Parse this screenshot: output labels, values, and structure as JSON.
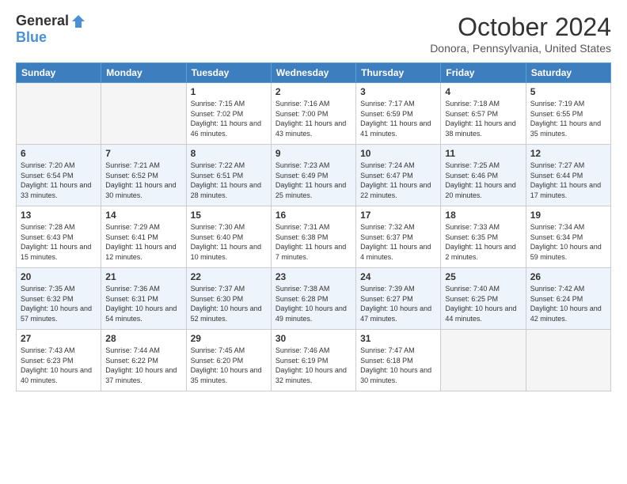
{
  "header": {
    "logo_general": "General",
    "logo_blue": "Blue",
    "title": "October 2024",
    "location": "Donora, Pennsylvania, United States"
  },
  "weekdays": [
    "Sunday",
    "Monday",
    "Tuesday",
    "Wednesday",
    "Thursday",
    "Friday",
    "Saturday"
  ],
  "weeks": [
    [
      {
        "day": "",
        "info": ""
      },
      {
        "day": "",
        "info": ""
      },
      {
        "day": "1",
        "info": "Sunrise: 7:15 AM\nSunset: 7:02 PM\nDaylight: 11 hours and 46 minutes."
      },
      {
        "day": "2",
        "info": "Sunrise: 7:16 AM\nSunset: 7:00 PM\nDaylight: 11 hours and 43 minutes."
      },
      {
        "day": "3",
        "info": "Sunrise: 7:17 AM\nSunset: 6:59 PM\nDaylight: 11 hours and 41 minutes."
      },
      {
        "day": "4",
        "info": "Sunrise: 7:18 AM\nSunset: 6:57 PM\nDaylight: 11 hours and 38 minutes."
      },
      {
        "day": "5",
        "info": "Sunrise: 7:19 AM\nSunset: 6:55 PM\nDaylight: 11 hours and 35 minutes."
      }
    ],
    [
      {
        "day": "6",
        "info": "Sunrise: 7:20 AM\nSunset: 6:54 PM\nDaylight: 11 hours and 33 minutes."
      },
      {
        "day": "7",
        "info": "Sunrise: 7:21 AM\nSunset: 6:52 PM\nDaylight: 11 hours and 30 minutes."
      },
      {
        "day": "8",
        "info": "Sunrise: 7:22 AM\nSunset: 6:51 PM\nDaylight: 11 hours and 28 minutes."
      },
      {
        "day": "9",
        "info": "Sunrise: 7:23 AM\nSunset: 6:49 PM\nDaylight: 11 hours and 25 minutes."
      },
      {
        "day": "10",
        "info": "Sunrise: 7:24 AM\nSunset: 6:47 PM\nDaylight: 11 hours and 22 minutes."
      },
      {
        "day": "11",
        "info": "Sunrise: 7:25 AM\nSunset: 6:46 PM\nDaylight: 11 hours and 20 minutes."
      },
      {
        "day": "12",
        "info": "Sunrise: 7:27 AM\nSunset: 6:44 PM\nDaylight: 11 hours and 17 minutes."
      }
    ],
    [
      {
        "day": "13",
        "info": "Sunrise: 7:28 AM\nSunset: 6:43 PM\nDaylight: 11 hours and 15 minutes."
      },
      {
        "day": "14",
        "info": "Sunrise: 7:29 AM\nSunset: 6:41 PM\nDaylight: 11 hours and 12 minutes."
      },
      {
        "day": "15",
        "info": "Sunrise: 7:30 AM\nSunset: 6:40 PM\nDaylight: 11 hours and 10 minutes."
      },
      {
        "day": "16",
        "info": "Sunrise: 7:31 AM\nSunset: 6:38 PM\nDaylight: 11 hours and 7 minutes."
      },
      {
        "day": "17",
        "info": "Sunrise: 7:32 AM\nSunset: 6:37 PM\nDaylight: 11 hours and 4 minutes."
      },
      {
        "day": "18",
        "info": "Sunrise: 7:33 AM\nSunset: 6:35 PM\nDaylight: 11 hours and 2 minutes."
      },
      {
        "day": "19",
        "info": "Sunrise: 7:34 AM\nSunset: 6:34 PM\nDaylight: 10 hours and 59 minutes."
      }
    ],
    [
      {
        "day": "20",
        "info": "Sunrise: 7:35 AM\nSunset: 6:32 PM\nDaylight: 10 hours and 57 minutes."
      },
      {
        "day": "21",
        "info": "Sunrise: 7:36 AM\nSunset: 6:31 PM\nDaylight: 10 hours and 54 minutes."
      },
      {
        "day": "22",
        "info": "Sunrise: 7:37 AM\nSunset: 6:30 PM\nDaylight: 10 hours and 52 minutes."
      },
      {
        "day": "23",
        "info": "Sunrise: 7:38 AM\nSunset: 6:28 PM\nDaylight: 10 hours and 49 minutes."
      },
      {
        "day": "24",
        "info": "Sunrise: 7:39 AM\nSunset: 6:27 PM\nDaylight: 10 hours and 47 minutes."
      },
      {
        "day": "25",
        "info": "Sunrise: 7:40 AM\nSunset: 6:25 PM\nDaylight: 10 hours and 44 minutes."
      },
      {
        "day": "26",
        "info": "Sunrise: 7:42 AM\nSunset: 6:24 PM\nDaylight: 10 hours and 42 minutes."
      }
    ],
    [
      {
        "day": "27",
        "info": "Sunrise: 7:43 AM\nSunset: 6:23 PM\nDaylight: 10 hours and 40 minutes."
      },
      {
        "day": "28",
        "info": "Sunrise: 7:44 AM\nSunset: 6:22 PM\nDaylight: 10 hours and 37 minutes."
      },
      {
        "day": "29",
        "info": "Sunrise: 7:45 AM\nSunset: 6:20 PM\nDaylight: 10 hours and 35 minutes."
      },
      {
        "day": "30",
        "info": "Sunrise: 7:46 AM\nSunset: 6:19 PM\nDaylight: 10 hours and 32 minutes."
      },
      {
        "day": "31",
        "info": "Sunrise: 7:47 AM\nSunset: 6:18 PM\nDaylight: 10 hours and 30 minutes."
      },
      {
        "day": "",
        "info": ""
      },
      {
        "day": "",
        "info": ""
      }
    ]
  ]
}
